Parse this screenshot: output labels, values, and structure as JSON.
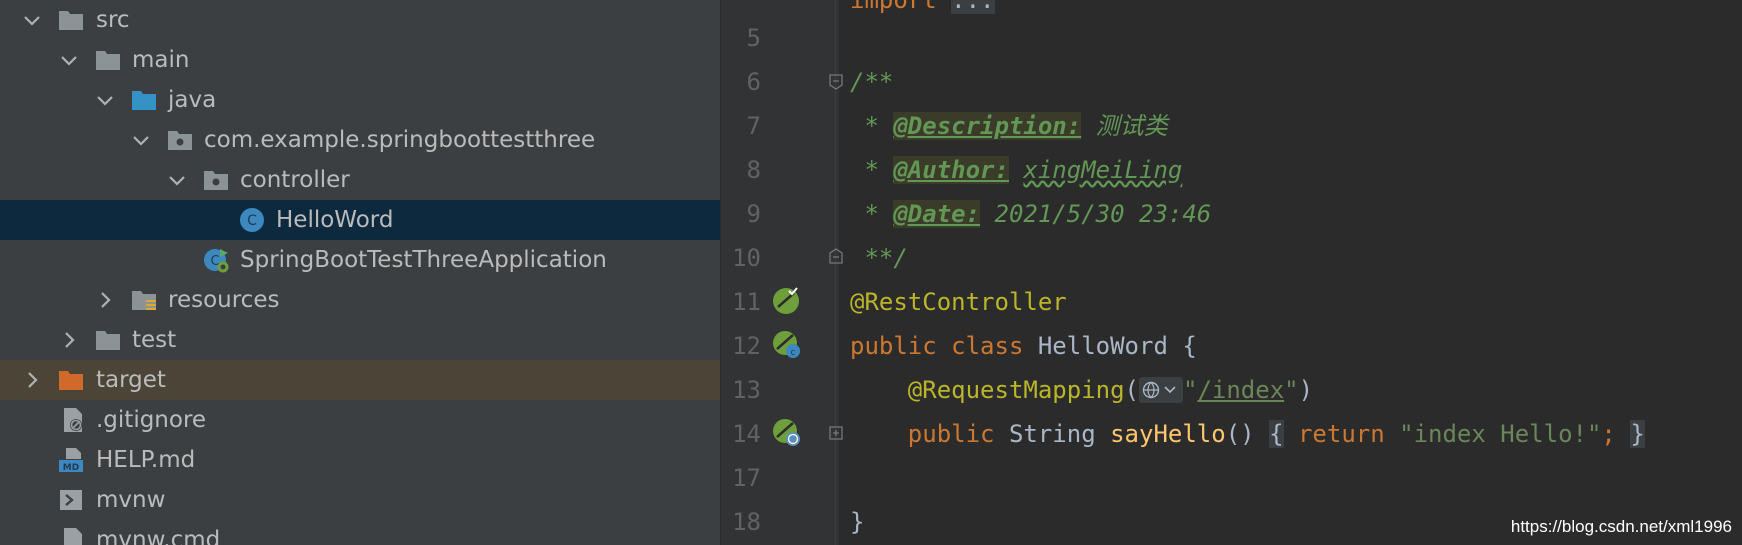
{
  "tree": {
    "items": [
      {
        "label": "src",
        "icon": "folder-icon",
        "expanded": true
      },
      {
        "label": "main",
        "icon": "folder-icon",
        "expanded": true
      },
      {
        "label": "java",
        "icon": "source-folder-icon",
        "expanded": true
      },
      {
        "label": "com.example.springboottestthree",
        "icon": "package-icon",
        "expanded": true
      },
      {
        "label": "controller",
        "icon": "package-icon",
        "expanded": true
      },
      {
        "label": "HelloWord",
        "icon": "java-class-icon",
        "selected": true
      },
      {
        "label": "SpringBootTestThreeApplication",
        "icon": "spring-boot-class-icon"
      },
      {
        "label": "resources",
        "icon": "resources-folder-icon",
        "expanded": false
      },
      {
        "label": "test",
        "icon": "folder-icon",
        "expanded": false
      },
      {
        "label": "target",
        "icon": "excluded-folder-icon",
        "expanded": false
      },
      {
        "label": ".gitignore",
        "icon": "gitignore-file-icon"
      },
      {
        "label": "HELP.md",
        "icon": "markdown-file-icon"
      },
      {
        "label": "mvnw",
        "icon": "shell-script-icon"
      },
      {
        "label": "mvnw.cmd",
        "icon": "file-icon"
      }
    ]
  },
  "editor": {
    "line_numbers": [
      "5",
      "6",
      "7",
      "8",
      "9",
      "10",
      "11",
      "12",
      "13",
      "14",
      "17",
      "18"
    ],
    "code": {
      "import_kw": "import",
      "import_fold": "...",
      "doc_open": "/**",
      "star": " * ",
      "desc_tag": "@Description:",
      "desc_text": " 测试类",
      "author_tag": "@Author:",
      "author_text": "xingMeiLing",
      "date_tag": "@Date:",
      "date_text": " 2021/5/30 23:46",
      "doc_close": " **/",
      "rest_controller": "@RestController",
      "public_kw": "public",
      "class_kw": "class",
      "class_name": "HelloWord",
      "open_brace": "{",
      "request_mapping": "@RequestMapping",
      "paren_open": "(",
      "quote": "\"",
      "mapping_path": "/index",
      "paren_close": ")",
      "string_type": "String",
      "method_name": "sayHello",
      "method_parens": "()",
      "return_kw": "return",
      "return_value": "\"index Hello!\"",
      "semicolon": ";",
      "close_brace": "}"
    }
  },
  "watermark": "https://blog.csdn.net/xml1996",
  "colors": {
    "selection": "#0d293e",
    "excluded_row": "#4b4437",
    "keyword": "#cc7832",
    "annotation": "#bbb529",
    "string": "#6a8759",
    "doc_comment": "#629755",
    "method": "#ffc66d"
  }
}
